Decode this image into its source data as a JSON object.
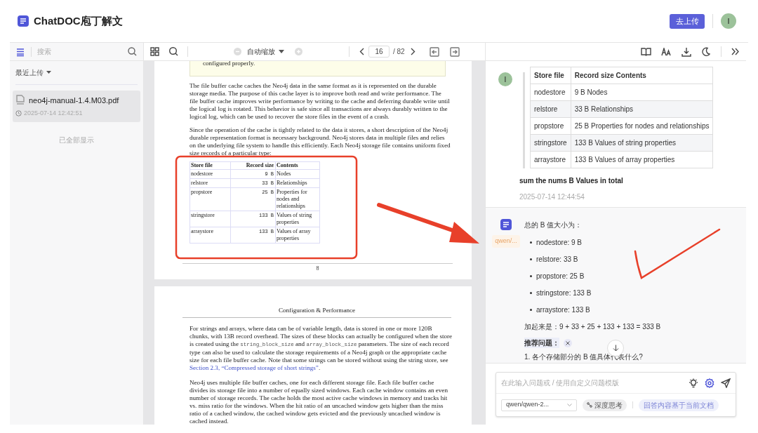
{
  "app": {
    "title": "ChatDOC庖丁解文",
    "upload_button": "去上传",
    "avatar": "I"
  },
  "sidebar": {
    "search_placeholder": "搜索",
    "filter": "最近上传",
    "files": [
      {
        "name": "neo4j-manual-1.4.M03.pdf",
        "time": "2025-07-14 12:42:51",
        "selected": true
      }
    ],
    "end_note": "已全部显示"
  },
  "viewer_toolbar": {
    "zoom": "自动缩放",
    "page": "16",
    "page_total": "/ 82"
  },
  "document": {
    "pages": [
      {
        "note": "configured properly.",
        "paragraphs": [
          [
            {
              "kind": "text",
              "text": "The file buffer cache caches the Neo4j data in the same format as it is represented on the durable storage media. The purpose of this cache layer is to improve both read and write performance. The file buffer cache improves write performance by writing to the cache and deferring durable write until the logical log is rotated. This behavior is safe since all transactions are always durably written to the logical log, which can be used to recover the store files in the event of a crash."
            }
          ],
          [
            {
              "kind": "text",
              "text": "Since the operation of the cache is tightly related to the data it stores, a short description of the Neo4j durable representation format is necessary background. Neo4j stores data in multiple files and relies on the underlying file system to handle this efficiently. Each Neo4j storage file contains uniform fixed size records of a particular type:"
            }
          ]
        ],
        "table": {
          "columns": [
            "Store file",
            "Record size",
            "Contents"
          ],
          "rows": [
            [
              "nodestore",
              "9 B",
              "Nodes"
            ],
            [
              "relstore",
              "33 B",
              "Relationships"
            ],
            [
              "propstore",
              "25 B",
              "Properties for nodes and relationships"
            ],
            [
              "stringstore",
              "133 B",
              "Values of string properties"
            ],
            [
              "arraystore",
              "133 B",
              "Values of array properties"
            ]
          ]
        },
        "page_number": "8"
      },
      {
        "header": "Configuration & Performance",
        "paragraphs": [
          [
            {
              "kind": "text",
              "text": "For strings and arrays, where data can be of variable length, data is stored in one or more 120B chunks, with 13B record overhead. The sizes of these blocks can actually be configured when the store is created using the "
            },
            {
              "kind": "code",
              "text": "string_block_size"
            },
            {
              "kind": "text",
              "text": " and "
            },
            {
              "kind": "code",
              "text": "array_block_size"
            },
            {
              "kind": "text",
              "text": " parameters. The size of each record type can also be used to calculate the storage requirements of a Neo4j graph or the appropriate cache size for each file buffer cache. Note that some strings can be stored without using the string store, see "
            },
            {
              "kind": "link",
              "text": "Section 2.3, “Compressed storage of short strings”"
            },
            {
              "kind": "text",
              "text": "."
            }
          ],
          [
            {
              "kind": "text",
              "text": "Neo4j uses multiple file buffer caches, one for each different storage file. Each file buffer cache divides its storage file into a number of equally sized windows. Each cache window contains an even number of storage records. The cache holds the most active cache windows in memory and tracks hit vs. miss ratio for the windows. When the hit ratio of an uncached window gets higher than the miss ratio of a cached window, the cached window gets evicted and the previously uncached window is cached instead."
            }
          ]
        ]
      }
    ]
  },
  "chat": {
    "user": {
      "avatar": "I",
      "table": {
        "columns": [
          "Store file",
          "Record size Contents"
        ],
        "rows": [
          [
            "nodestore",
            "9 B Nodes"
          ],
          [
            "relstore",
            "33 B Relationships"
          ],
          [
            "propstore",
            "25 B Properties for nodes and relationships"
          ],
          [
            "stringstore",
            "133 B Values of string properties"
          ],
          [
            "arraystore",
            "133 B Values of array properties"
          ]
        ]
      },
      "text": "sum the nums B Values in total",
      "time": "2025-07-14 12:44:54"
    },
    "assistant": {
      "model_tag": "qwen/...",
      "intro": "总的 B 值大小为：",
      "bullets": [
        "nodestore: 9 B",
        "relstore: 33 B",
        "propstore: 25 B",
        "stringstore: 133 B",
        "arraystore: 133 B"
      ],
      "sum": "加起来是：9 + 33 + 25 + 133 + 133 = 333 B",
      "suggest_label": "推荐问题：",
      "suggestions": [
        "1. 各个存储部分的 B 值具体代表什么?"
      ]
    },
    "input": {
      "placeholder": "在此输入问题或 / 使用自定义问题模版",
      "model": "qwen/qwen-2...",
      "deep_think": "深度思考",
      "scope": "回答内容基于当前文档"
    }
  }
}
